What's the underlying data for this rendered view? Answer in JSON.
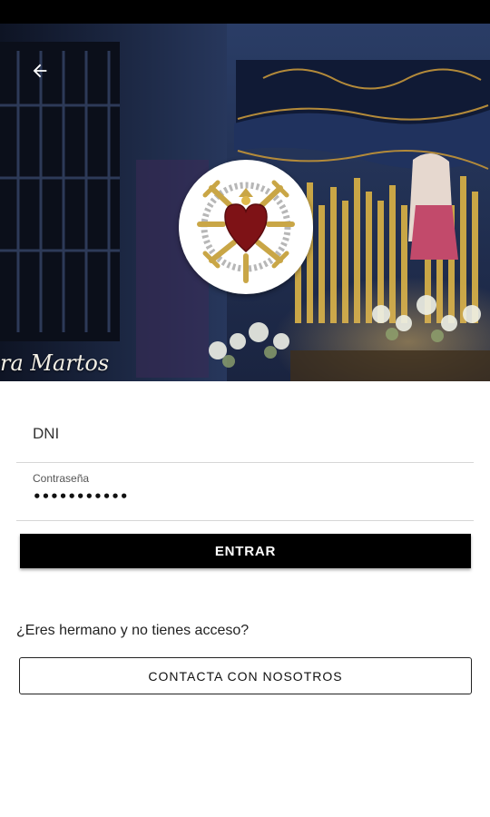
{
  "hero": {
    "watermark": "ra Martos",
    "icons": {
      "back": "arrow-left-icon",
      "crest": "brotherhood-crest-icon"
    }
  },
  "login": {
    "dni_placeholder": "DNI",
    "password_label": "Contraseña",
    "password_value": "•••••••••••",
    "enter_button": "ENTRAR"
  },
  "contact": {
    "question": "¿Eres hermano y no tienes acceso?",
    "button": "CONTACTA CON NOSOTROS"
  },
  "colors": {
    "primary_button": "#000000",
    "background": "#ffffff",
    "hero_sky": "#1b2a4a",
    "candle_gold": "#c9a646",
    "heart_red": "#8b1a1a"
  }
}
